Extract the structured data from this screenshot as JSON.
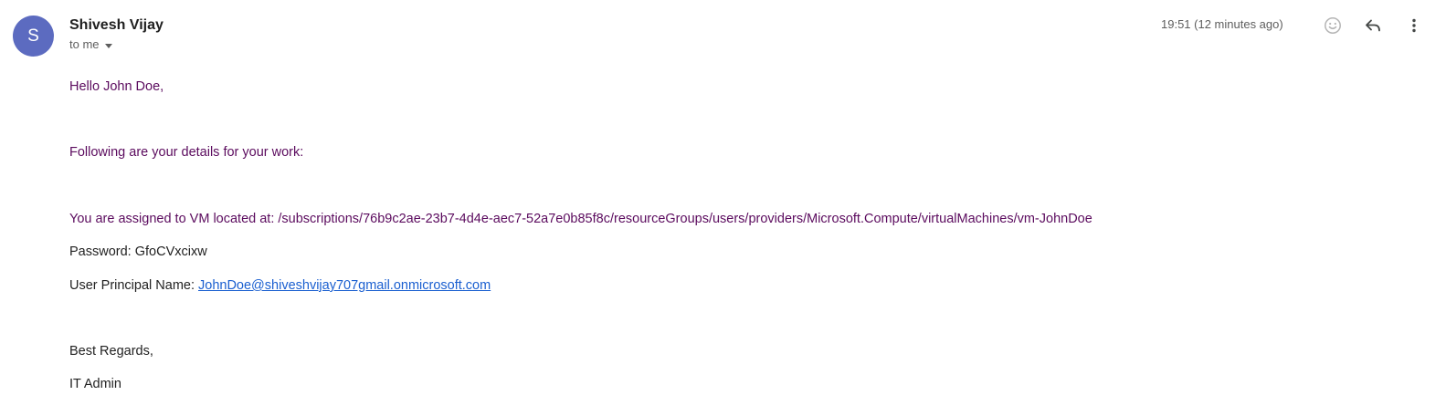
{
  "sender": {
    "initial": "S",
    "name": "Shivesh Vijay",
    "avatar_color": "#5c6bc0"
  },
  "recipient_label": "to me",
  "timestamp": "19:51 (12 minutes ago)",
  "icons": {
    "emoji": "smiley-icon",
    "reply": "reply-icon",
    "more": "more-vert-icon",
    "recipient_dropdown": "caret-down-icon"
  },
  "message": {
    "greeting": "Hello John Doe,",
    "intro": "Following are your details for your work:",
    "vm_line": "You are assigned to VM located at: /subscriptions/76b9c2ae-23b7-4d4e-aec7-52a7e0b85f8c/resourceGroups/users/providers/Microsoft.Compute/virtualMachines/vm-JohnDoe",
    "password_line": "Password: GfoCVxcixw",
    "upn_label": "User Principal Name: ",
    "upn_value": "JohnDoe@shiveshvijay707gmail.onmicrosoft.com",
    "closing": "Best Regards,",
    "signature": "IT Admin"
  },
  "colors": {
    "message_purple": "#5b0b5e",
    "link_blue": "#1a5fd0",
    "icon_gray": "#444746"
  }
}
